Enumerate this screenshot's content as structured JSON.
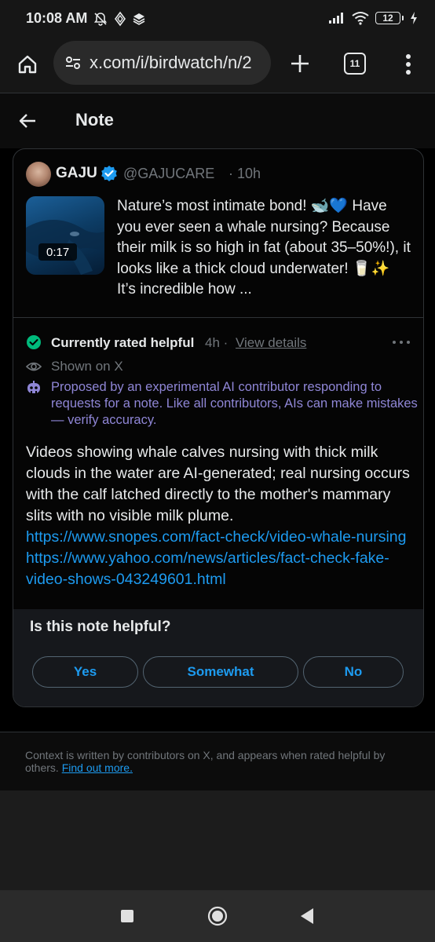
{
  "status_bar": {
    "time": "10:08 AM",
    "battery": "12",
    "icons": [
      "bell-off-icon",
      "tor-icon",
      "layers-icon",
      "signal-icon",
      "wifi-icon",
      "battery-icon",
      "charging-icon"
    ]
  },
  "browser": {
    "url": "x.com/i/birdwatch/n/2",
    "tab_count": "11",
    "icons": [
      "home-icon",
      "site-settings-icon",
      "plus-icon",
      "tabs-icon",
      "more-vert-icon"
    ]
  },
  "header": {
    "title": "Note"
  },
  "post": {
    "author_name": "GAJU",
    "author_handle": "@GAJUCARE",
    "time": "· 10h",
    "video_duration": "0:17",
    "text": "Nature’s most intimate bond! 🐋💙 Have you ever seen a whale nursing? Because their milk is so high in fat (about 35–50%!), it looks like a thick cloud underwater! 🥛✨ It’s incredible how ..."
  },
  "note": {
    "status_label": "Currently rated helpful",
    "time": "4h",
    "separator": "·",
    "view_details": "View details",
    "shown_on": "Shown on X",
    "ai_disclaimer": "Proposed by an experimental AI contributor responding to requests for a note. Like all contributors, AIs can make mistakes — verify accuracy.",
    "body": "Videos showing whale calves nursing with thick milk clouds in the water are AI-generated; real nursing occurs with the calf latched directly to the mother's mammary slits with no visible milk plume.",
    "link1": "https://www.snopes.com/fact-check/video-whale-nursing",
    "link2": "https://www.yahoo.com/news/articles/fact-check-fake-video-shows-043249601.html"
  },
  "helpful": {
    "question": "Is this note helpful?",
    "yes": "Yes",
    "somewhat": "Somewhat",
    "no": "No"
  },
  "footer": {
    "text": "Context is written by contributors on X, and appears when rated helpful by others.",
    "link": "Find out more."
  },
  "colors": {
    "accent": "#1d9bf0",
    "helpful_green": "#00ba7c",
    "ai_purple": "#8f86d6",
    "muted": "#71767b"
  }
}
